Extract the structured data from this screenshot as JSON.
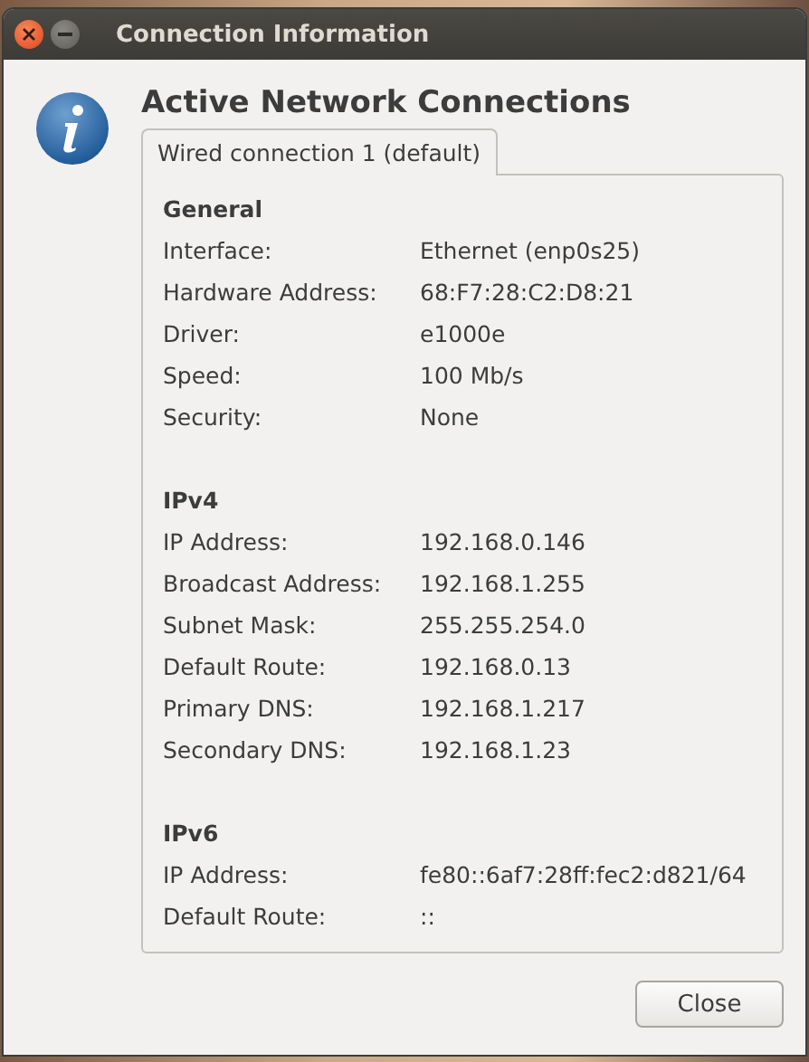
{
  "window": {
    "title": "Connection Information"
  },
  "heading": "Active Network Connections",
  "tabs": [
    {
      "label": "Wired connection 1 (default)",
      "selected": true
    }
  ],
  "sections": [
    {
      "title": "General",
      "rows": [
        {
          "label": "Interface:",
          "value": "Ethernet (enp0s25)"
        },
        {
          "label": "Hardware Address:",
          "value": "68:F7:28:C2:D8:21"
        },
        {
          "label": "Driver:",
          "value": "e1000e"
        },
        {
          "label": "Speed:",
          "value": "100 Mb/s"
        },
        {
          "label": "Security:",
          "value": "None"
        }
      ]
    },
    {
      "title": "IPv4",
      "rows": [
        {
          "label": "IP Address:",
          "value": "192.168.0.146"
        },
        {
          "label": "Broadcast Address:",
          "value": "192.168.1.255"
        },
        {
          "label": "Subnet Mask:",
          "value": "255.255.254.0"
        },
        {
          "label": "Default Route:",
          "value": "192.168.0.13"
        },
        {
          "label": "Primary DNS:",
          "value": "192.168.1.217"
        },
        {
          "label": "Secondary DNS:",
          "value": "192.168.1.23"
        }
      ]
    },
    {
      "title": "IPv6",
      "rows": [
        {
          "label": "IP Address:",
          "value": "fe80::6af7:28ff:fec2:d821/64"
        },
        {
          "label": "Default Route:",
          "value": "::"
        }
      ]
    }
  ],
  "buttons": [
    {
      "label": "Close"
    }
  ]
}
